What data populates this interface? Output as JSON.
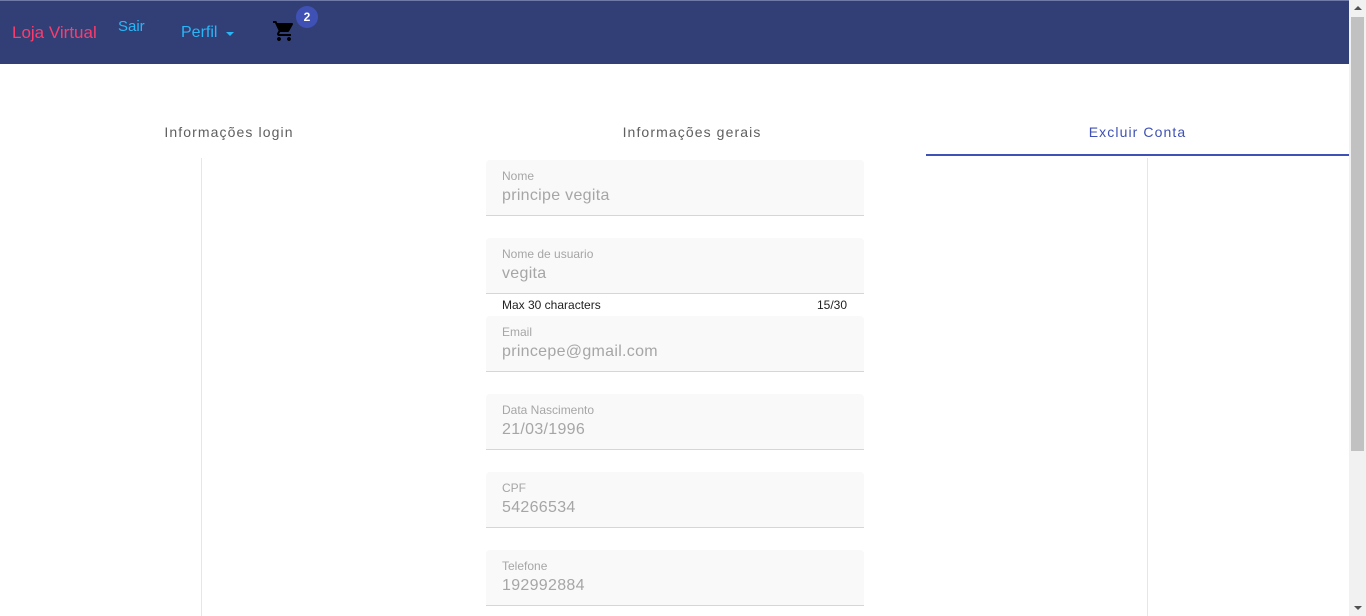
{
  "navbar": {
    "brand": "Loja Virtual",
    "logout_label": "Sair",
    "profile_label": "Perfil",
    "cart_icon": "shopping-cart-icon",
    "cart_count": "2",
    "colors": {
      "background": "#323f77",
      "brand": "#ff3b6b",
      "links": "#29b6f6",
      "badge": "#3f51b5"
    }
  },
  "tabs": [
    {
      "label": "Informações login",
      "active": false
    },
    {
      "label": "Informações gerais",
      "active": false
    },
    {
      "label": "Excluir Conta",
      "active": true
    }
  ],
  "form": {
    "nome": {
      "label": "Nome",
      "value": "principe vegita"
    },
    "usuario": {
      "label": "Nome de usuario",
      "value": "vegita",
      "hint": "Max 30 characters",
      "counter": "15/30"
    },
    "email": {
      "label": "Email",
      "value": "princepe@gmail.com"
    },
    "nascimento": {
      "label": "Data Nascimento",
      "value": "21/03/1996"
    },
    "cpf": {
      "label": "CPF",
      "value": "54266534"
    },
    "telefone": {
      "label": "Telefone",
      "value": "192992884"
    }
  },
  "accent_color": "#3f51b5"
}
